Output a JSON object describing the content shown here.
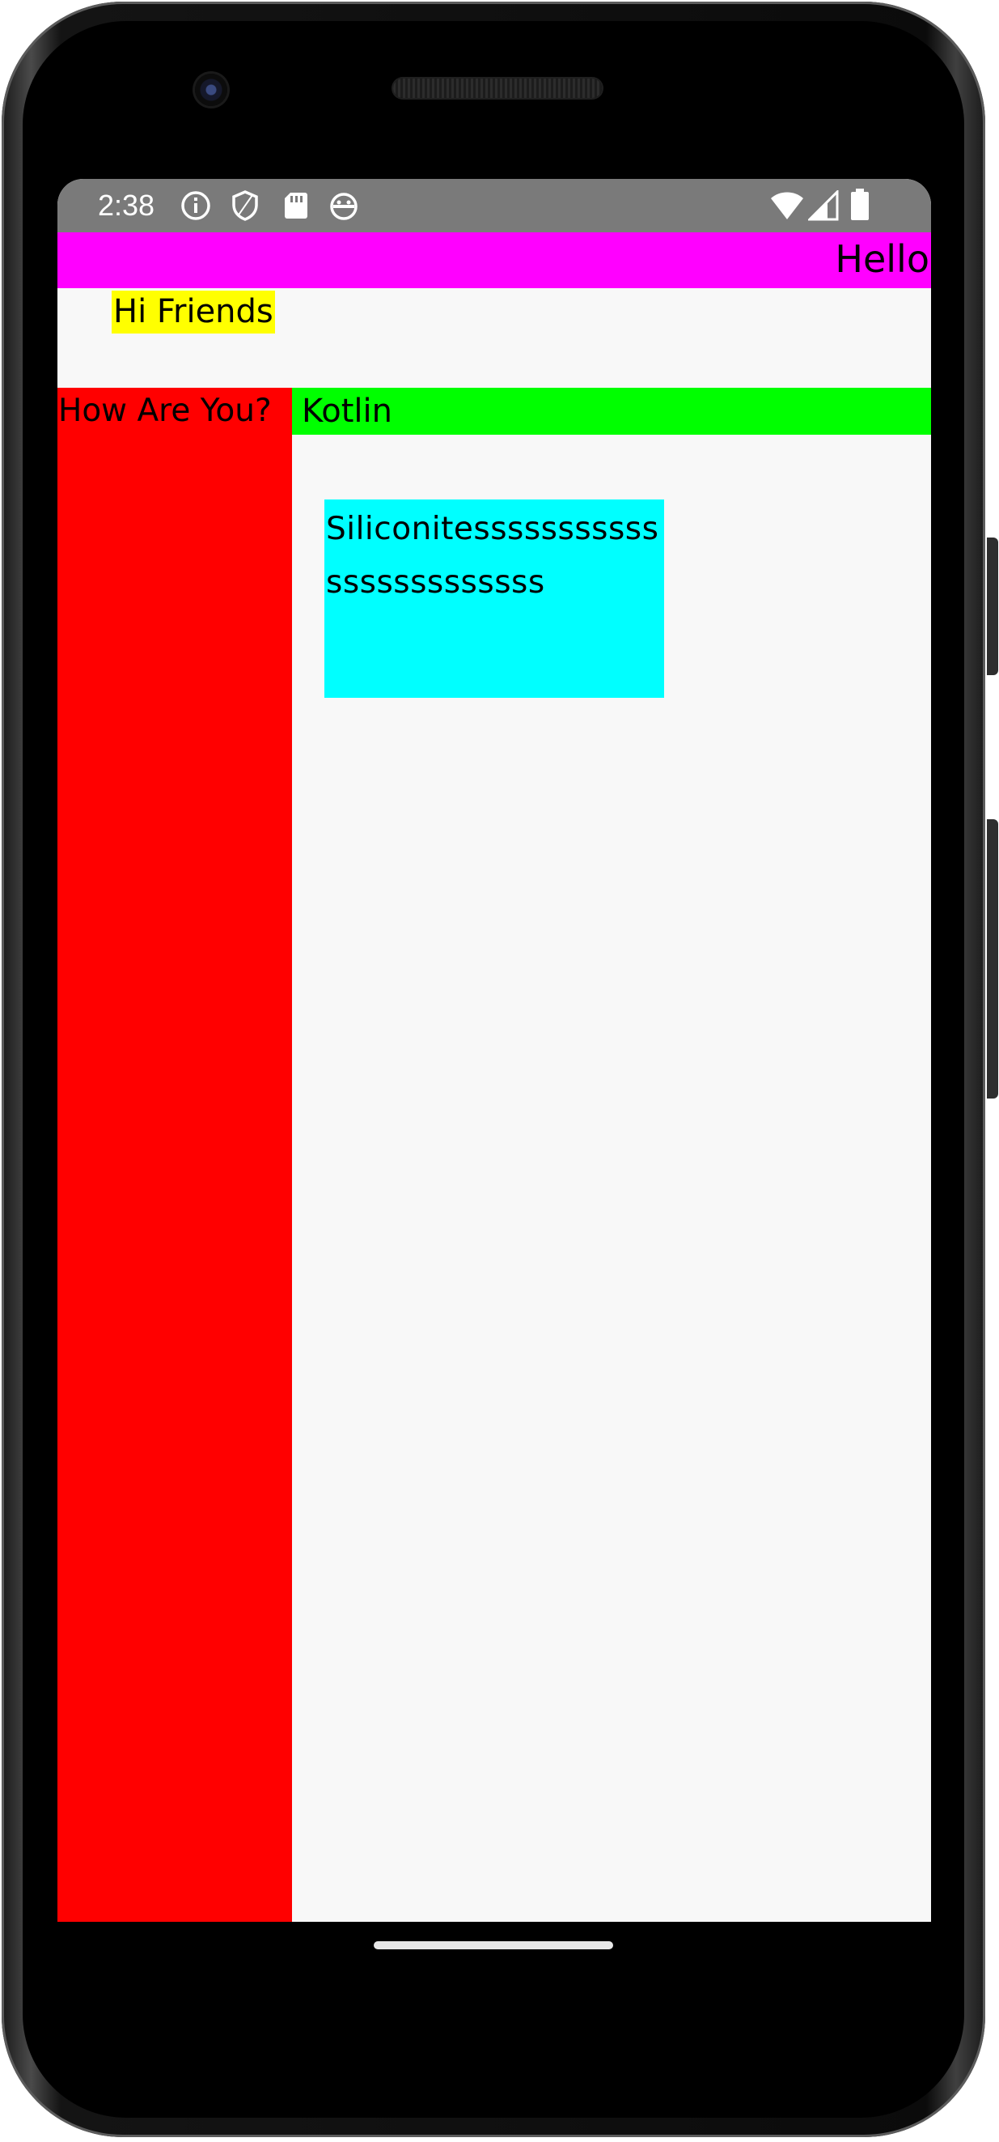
{
  "status_bar": {
    "time": "2:38",
    "left_icons": [
      "info-icon",
      "shield-icon",
      "sd-card-icon",
      "android-face-icon"
    ],
    "right_icons": [
      "wifi-icon",
      "signal-icon",
      "battery-icon"
    ]
  },
  "colors": {
    "magenta_bar": "#ff00ff",
    "yellow_label": "#ffff00",
    "red_column": "#ff0000",
    "green_bar": "#00ff00",
    "cyan_box": "#00ffff",
    "status_bar": "#7a7a7a",
    "screen_bg": "#f8f8f8"
  },
  "content": {
    "hello": "Hello",
    "hi_friends": "Hi Friends",
    "how_are_you": "How Are You?",
    "kotlin": "Kotlin",
    "siliconites": "Siliconitessssssssssssssssssssssss"
  }
}
